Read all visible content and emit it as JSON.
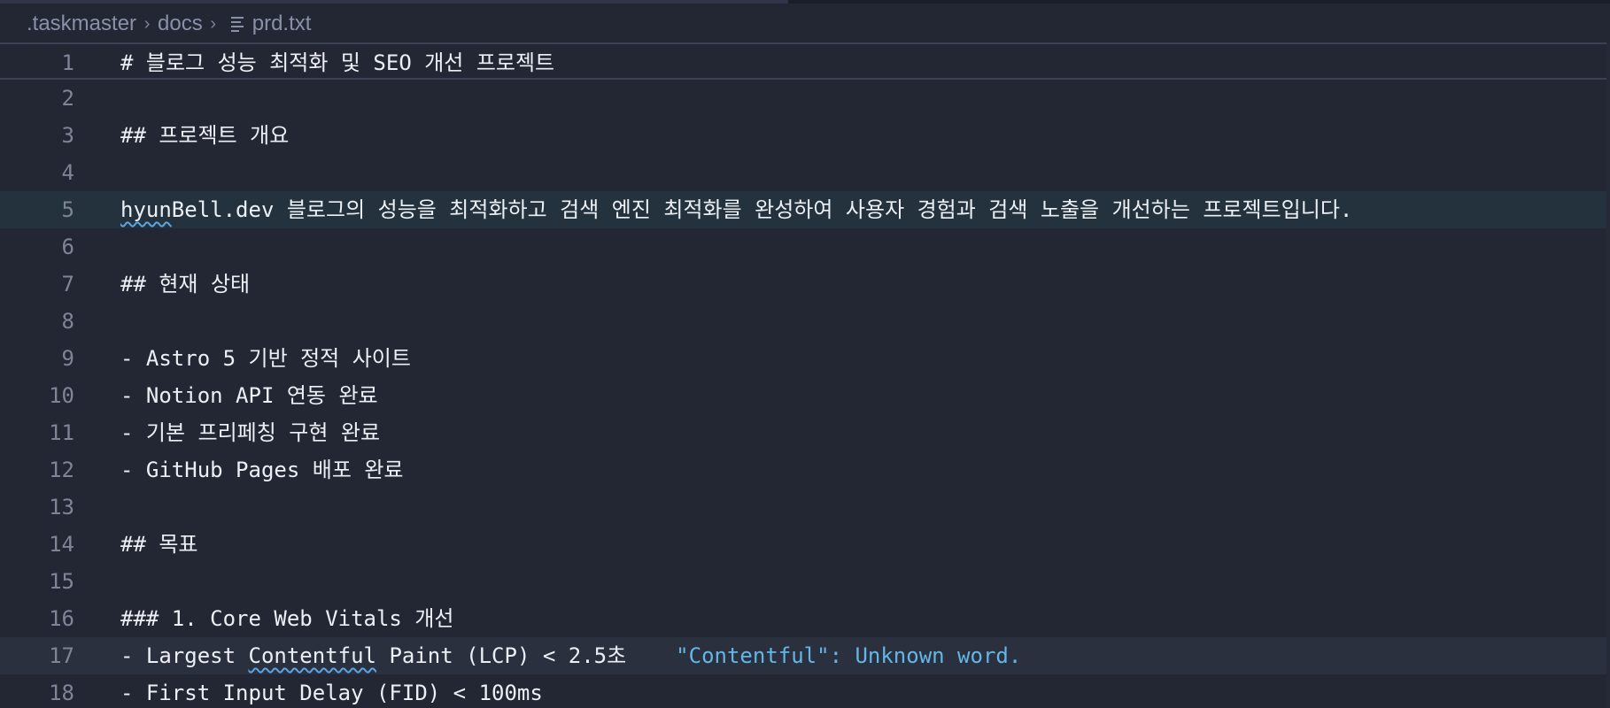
{
  "breadcrumb": {
    "parts": [
      ".taskmaster",
      "docs",
      "prd.txt"
    ],
    "separator": "›"
  },
  "editor": {
    "lines": [
      {
        "n": "1",
        "text": "# 블로그 성능 최적화 및 SEO 개선 프로젝트"
      },
      {
        "n": "2",
        "text": ""
      },
      {
        "n": "3",
        "text": "## 프로젝트 개요"
      },
      {
        "n": "4",
        "text": ""
      },
      {
        "n": "5",
        "pre": "",
        "squiggle": "hyun",
        "post": "Bell.dev 블로그의 성능을 최적화하고 검색 엔진 최적화를 완성하여 사용자 경험과 검색 노출을 개선하는 프로젝트입니다."
      },
      {
        "n": "6",
        "text": ""
      },
      {
        "n": "7",
        "text": "## 현재 상태"
      },
      {
        "n": "8",
        "text": ""
      },
      {
        "n": "9",
        "text": "- Astro 5 기반 정적 사이트"
      },
      {
        "n": "10",
        "text": "- Notion API 연동 완료"
      },
      {
        "n": "11",
        "text": "- 기본 프리페칭 구현 완료"
      },
      {
        "n": "12",
        "text": "- GitHub Pages 배포 완료"
      },
      {
        "n": "13",
        "text": ""
      },
      {
        "n": "14",
        "text": "## 목표"
      },
      {
        "n": "15",
        "text": ""
      },
      {
        "n": "16",
        "text": "### 1. Core Web Vitals 개선"
      },
      {
        "n": "17",
        "pre": "- Largest ",
        "squiggle": "Contentful",
        "post": " Paint (LCP) < 2.5초",
        "diagnostic": "\"Contentful\": Unknown word."
      },
      {
        "n": "18",
        "text": "- First Input Delay (FID) < 100ms"
      }
    ]
  },
  "colors": {
    "background": "#232734",
    "text": "#eceff4",
    "line_number": "#7f8496",
    "diagnostic": "#62b7e6",
    "squiggle": "#5aa6e4"
  }
}
